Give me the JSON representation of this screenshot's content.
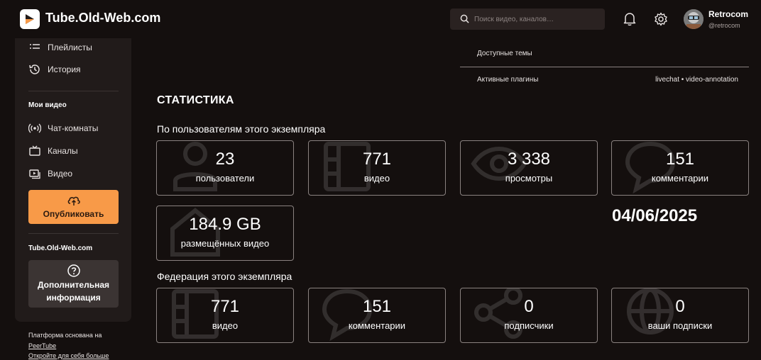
{
  "header": {
    "brand": "Tube.Old-Web.com",
    "search_placeholder": "Поиск видео, каналов…",
    "user_name": "Retrocom",
    "user_handle": "@retrocom"
  },
  "sidebar": {
    "playlists": "Плейлисты",
    "history": "История",
    "my_videos_section": "Мои видео",
    "chat_rooms": "Чат-комнаты",
    "channels": "Каналы",
    "videos": "Видео",
    "publish": "Опубликовать",
    "instance_section": "Tube.Old-Web.com",
    "more_info_line1": "Дополнительная",
    "more_info_line2": "информация",
    "footer_line1": "Платформа основана на",
    "footer_link1": "PeerTube",
    "footer_link2": "Откройте для себя больше"
  },
  "properties": {
    "themes_label": "Доступные темы",
    "plugins_label": "Активные плагины",
    "plugins_value": "livechat • video-annotation"
  },
  "stats": {
    "title": "СТАТИСТИКА",
    "users_section": "По пользователям этого экземпляра",
    "users": {
      "value": "23",
      "label": "пользователи"
    },
    "videos": {
      "value": "771",
      "label": "видео"
    },
    "views": {
      "value": "3 338",
      "label": "просмотры"
    },
    "comments": {
      "value": "151",
      "label": "комментарии"
    },
    "storage": {
      "value": "184.9 GB",
      "label": "размещённых видео"
    },
    "date": "04/06/2025",
    "federation_section": "Федерация этого экземпляра",
    "fed_videos": {
      "value": "771",
      "label": "видео"
    },
    "fed_comments": {
      "value": "151",
      "label": "комментарии"
    },
    "fed_followers": {
      "value": "0",
      "label": "подписчики"
    },
    "fed_following": {
      "value": "0",
      "label": "ваши подписки"
    }
  },
  "colors": {
    "background": "#140f0e",
    "sidebar": "#211b1a",
    "accent": "#f89a48",
    "card_border": "#8a8280"
  }
}
